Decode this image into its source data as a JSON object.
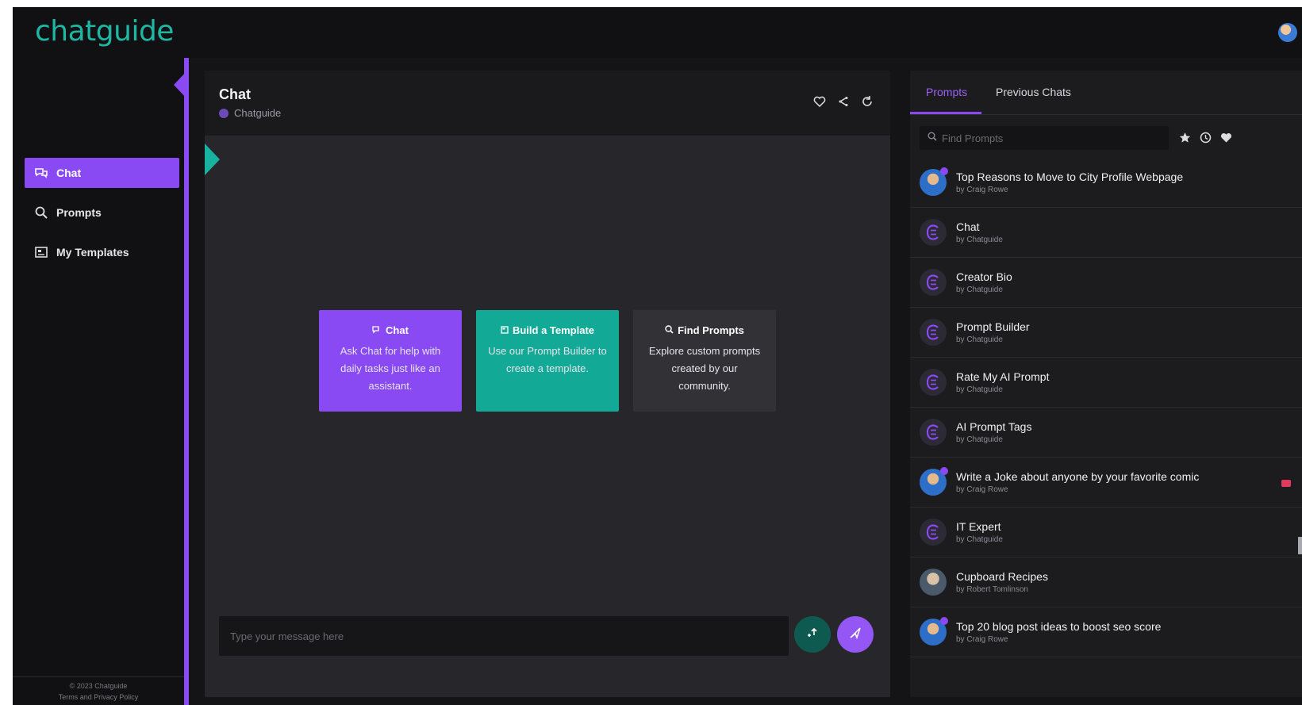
{
  "app": {
    "logo": "chatguide",
    "accent": "#8a4af3",
    "teal": "#12a996"
  },
  "sidebar": {
    "items": [
      {
        "label": "Chat",
        "icon": "chat-bubbles-icon",
        "active": true
      },
      {
        "label": "Prompts",
        "icon": "search-icon",
        "active": false
      },
      {
        "label": "My Templates",
        "icon": "template-icon",
        "active": false
      }
    ],
    "footer_line1": "© 2023 Chatguide",
    "footer_line2": "Terms and Privacy Policy"
  },
  "chat": {
    "title": "Chat",
    "subtitle": "Chatguide",
    "cards": [
      {
        "title": "Chat",
        "desc": "Ask Chat for help with daily tasks just like an assistant.",
        "icon": "chat-icon"
      },
      {
        "title": "Build a Template",
        "desc": "Use our Prompt Builder to create a template.",
        "icon": "template-icon"
      },
      {
        "title": "Find Prompts",
        "desc": "Explore custom prompts created by our community.",
        "icon": "search-icon"
      }
    ],
    "input_placeholder": "Type your message here"
  },
  "right_panel": {
    "tabs": [
      "Prompts",
      "Previous Chats"
    ],
    "active_tab": "Prompts",
    "search_placeholder": "Find Prompts",
    "prompts": [
      {
        "title": "Top Reasons to Move to City Profile Webpage",
        "by": "by Craig Rowe",
        "avatar": "person"
      },
      {
        "title": "Chat",
        "by": "by Chatguide",
        "avatar": "chatguide"
      },
      {
        "title": "Creator Bio",
        "by": "by Chatguide",
        "avatar": "chatguide"
      },
      {
        "title": "Prompt Builder",
        "by": "by Chatguide",
        "avatar": "chatguide"
      },
      {
        "title": "Rate My AI Prompt",
        "by": "by Chatguide",
        "avatar": "chatguide"
      },
      {
        "title": "AI Prompt Tags",
        "by": "by Chatguide",
        "avatar": "chatguide"
      },
      {
        "title": "Write a Joke about anyone by your favorite comic",
        "by": "by Craig Rowe",
        "avatar": "person",
        "favorited": true
      },
      {
        "title": "IT Expert",
        "by": "by Chatguide",
        "avatar": "chatguide"
      },
      {
        "title": "Cupboard Recipes",
        "by": "by Robert Tomlinson",
        "avatar": "person2"
      },
      {
        "title": "Top 20 blog post ideas to boost seo score",
        "by": "by Craig Rowe",
        "avatar": "person"
      }
    ]
  }
}
